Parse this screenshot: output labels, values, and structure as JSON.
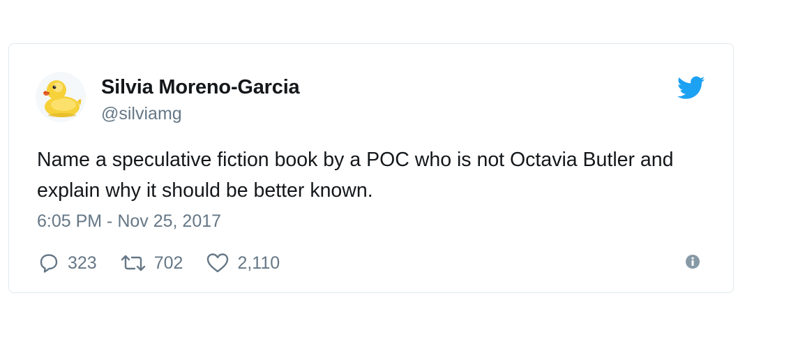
{
  "tweet": {
    "author_name": "Silvia Moreno-Garcia",
    "author_handle": "@silviamg",
    "text": "Name a speculative fiction book by a POC who is not Octavia Butler and explain why it should be better known.",
    "timestamp": "6:05 PM - Nov 25, 2017",
    "avatar_icon": "rubber-duck-icon",
    "brand_icon": "twitter-bird-icon"
  },
  "actions": {
    "replies": "323",
    "retweets": "702",
    "likes": "2,110"
  },
  "colors": {
    "twitter_blue": "#1da1f2",
    "text_primary": "#14171a",
    "text_secondary": "#657786",
    "card_border": "#e1e8ed"
  }
}
